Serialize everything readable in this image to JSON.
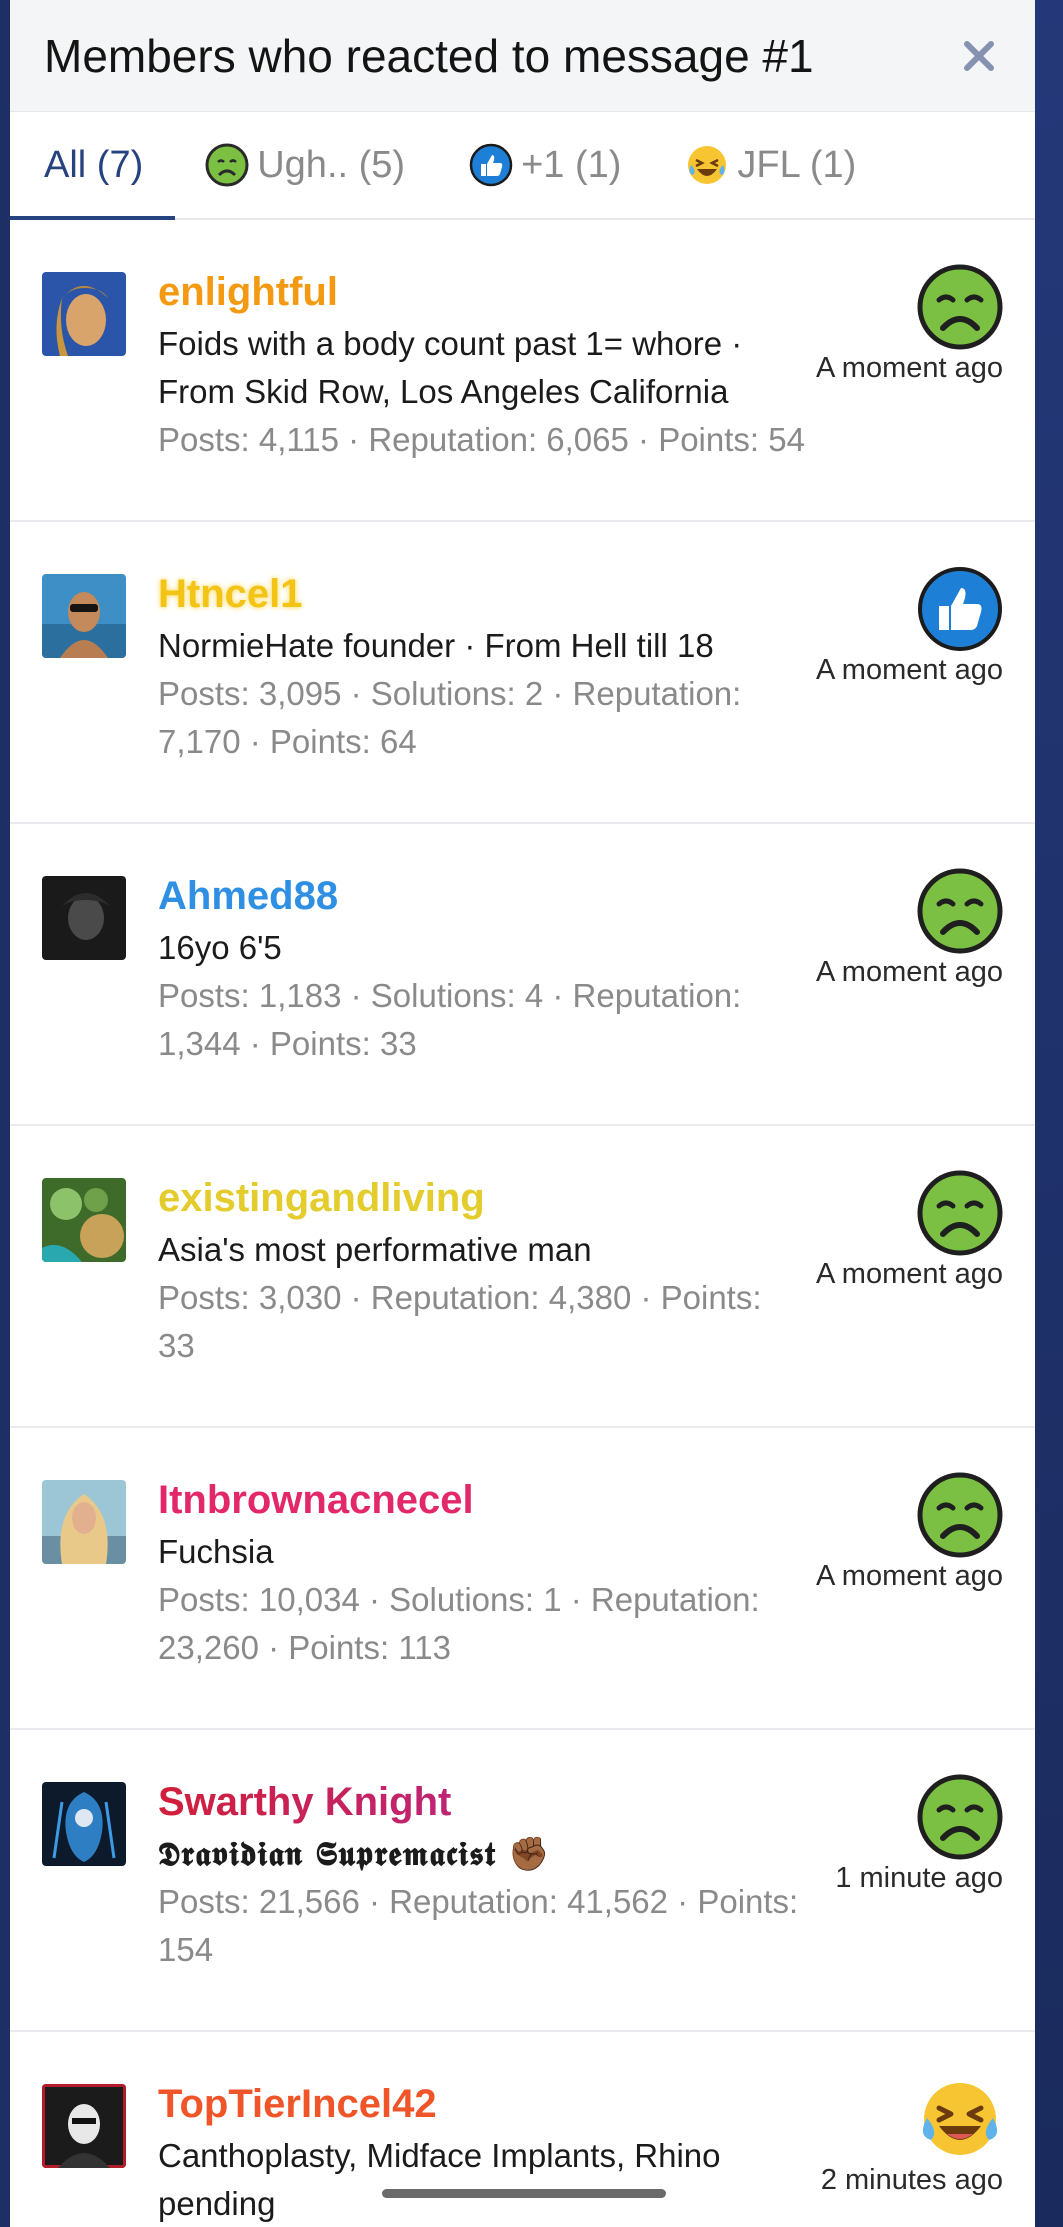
{
  "modal": {
    "title": "Members who reacted to message #1",
    "close_label": "×"
  },
  "tabs": [
    {
      "label": "All (7)",
      "icon": "none",
      "active": true
    },
    {
      "label": "Ugh.. (5)",
      "icon": "nauseated-face-icon",
      "active": false
    },
    {
      "label": "+1 (1)",
      "icon": "thumbs-up-icon",
      "active": false
    },
    {
      "label": "JFL (1)",
      "icon": "laughing-crying-face-icon",
      "active": false
    }
  ],
  "members": [
    {
      "username": "enlightful",
      "username_color": "#f39a12",
      "title_line": "Foids with a body count past 1= whore · From Skid Row, Los Angeles California",
      "title_line_1": "Foids with a body count past 1= whore ·",
      "title_line_2": "From Skid Row, Los Angeles California",
      "stats_1": "Posts: 4,115 · Reputation: 6,065 · Points: 54",
      "stats_2": "",
      "reaction": "nauseated-face-icon",
      "time": "A moment ago"
    },
    {
      "username": "Htncel1",
      "username_color": "#f3c415",
      "title_line_1": "NormieHate founder · From Hell till 18",
      "title_line_2": "",
      "stats_1": "Posts: 3,095 · Solutions: 2 · Reputation:",
      "stats_2": "7,170 · Points: 64",
      "reaction": "thumbs-up-icon",
      "time": "A moment ago"
    },
    {
      "username": "Ahmed88",
      "username_color": "#2f8fe3",
      "title_line_1": "16yo 6'5",
      "title_line_2": "",
      "stats_1": "Posts: 1,183 · Solutions: 4 · Reputation:",
      "stats_2": "1,344 · Points: 33",
      "reaction": "nauseated-face-icon",
      "time": "A moment ago"
    },
    {
      "username": "existingandliving",
      "username_color": "#e3cc2b",
      "title_line_1": "Asia's most performative man",
      "title_line_2": "",
      "stats_1": "Posts: 3,030 · Reputation: 4,380 · Points:",
      "stats_2": "33",
      "reaction": "nauseated-face-icon",
      "time": "A moment ago"
    },
    {
      "username": "Itnbrownacnecel",
      "username_color": "#e3286a",
      "title_line_1": "Fuchsia",
      "title_line_2": "",
      "stats_1": "Posts: 10,034 · Solutions: 1 · Reputation:",
      "stats_2": "23,260 · Points: 113",
      "reaction": "nauseated-face-icon",
      "time": "A moment ago"
    },
    {
      "username": "Swarthy Knight",
      "username_color": "#c51b3d",
      "title_line_1": "𝕯𝖗𝖆𝖛𝖎𝖉𝖎𝖆𝖓 𝕾𝖚𝖕𝖗𝖊𝖒𝖆𝖈𝖎𝖘𝖙 ✊🏾",
      "title_line_2": "",
      "stats_1": "Posts: 21,566 · Reputation: 41,562 · Points:",
      "stats_2": "154",
      "reaction": "nauseated-face-icon",
      "time": "1 minute ago"
    },
    {
      "username": "TopTierIncel42",
      "username_color": "#f0552a",
      "title_line_1": "Canthoplasty, Midface Implants, Rhino",
      "title_line_2": "pending",
      "stats_1": "",
      "stats_2": "",
      "reaction": "laughing-crying-face-icon",
      "time": "2 minutes ago"
    }
  ]
}
